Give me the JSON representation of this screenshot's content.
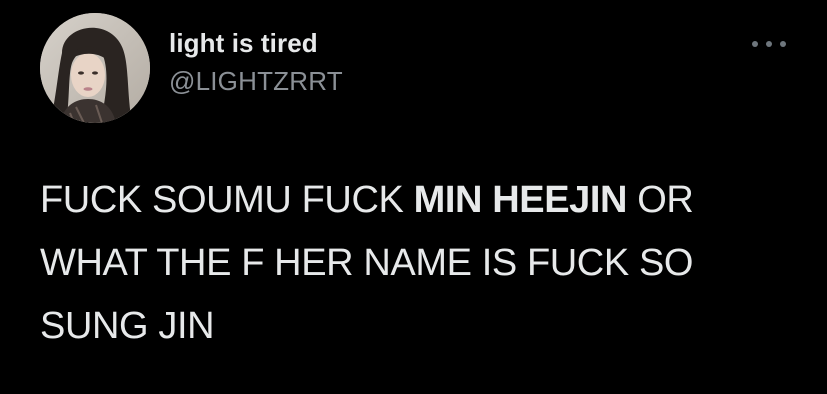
{
  "tweet": {
    "display_name": "light is tired",
    "handle": "@LIGHTZRRT",
    "more_icon": "more-horizontal-icon",
    "avatar_icon": "profile-photo",
    "text": {
      "part1": "FUCK SOUMU FUCK ",
      "bold": "MIN HEEJIN",
      "part2": " OR WHAT THE F HER NAME IS FUCK SO SUNG JIN"
    }
  },
  "colors": {
    "background": "#000000",
    "text_primary": "#e7e9ea",
    "text_secondary": "#8b9096",
    "icon_gray": "#6e767d"
  }
}
